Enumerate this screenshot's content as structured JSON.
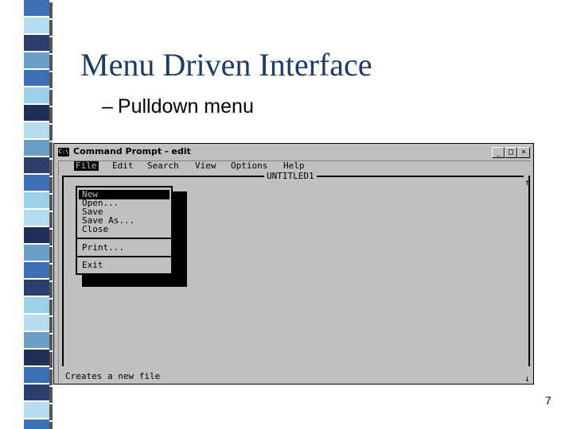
{
  "slide": {
    "title": "Menu Driven Interface",
    "subtitle_dash": "–",
    "subtitle": "Pulldown menu",
    "page_number": "7"
  },
  "window": {
    "system_icon": "C:\\",
    "title": "Command Prompt - edit",
    "minimize": "_",
    "maximize": "□",
    "close": "×"
  },
  "menubar": {
    "file": "File",
    "edit": "Edit",
    "search": "Search",
    "view": "View",
    "options": "Options",
    "help": "Help"
  },
  "document": {
    "title": "UNTITLED1"
  },
  "file_menu": {
    "new": "New",
    "open": "Open...",
    "save": "Save",
    "save_as": "Save As...",
    "close": "Close",
    "print": "Print...",
    "exit": "Exit"
  },
  "scrollbar": {
    "up": "↑",
    "down": "↓"
  },
  "status": {
    "text": "Creates a new file"
  },
  "colors": {
    "title_text": "#1f3a64",
    "dos_background": "#c0c0c0",
    "strip_colors": [
      "#3c6fb4",
      "#2a3f6b",
      "#b8dcef",
      "#6aa0c6",
      "#1f2f55",
      "#9bd0e8"
    ]
  }
}
